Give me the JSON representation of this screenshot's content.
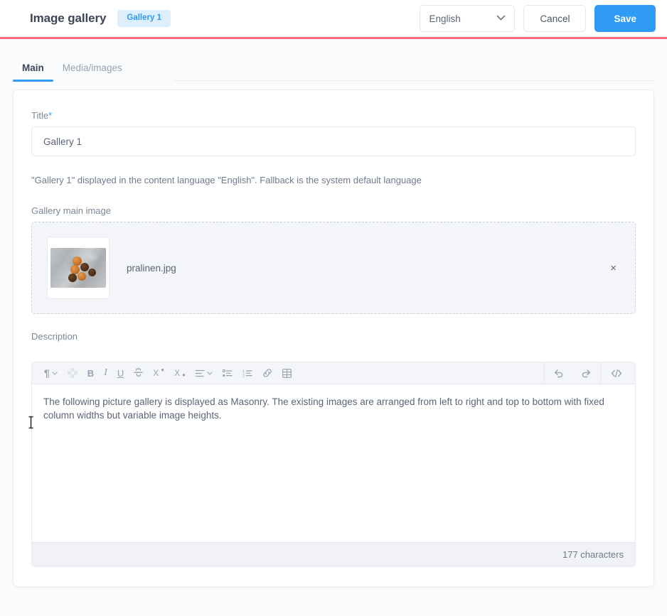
{
  "header": {
    "title": "Image gallery",
    "badge": "Gallery 1",
    "language": "English",
    "cancel_label": "Cancel",
    "save_label": "Save",
    "accent_color": "#2f9bf5",
    "rule_color": "#f4697c"
  },
  "tabs": [
    {
      "label": "Main",
      "active": true
    },
    {
      "label": "Media/images",
      "active": false
    }
  ],
  "form": {
    "title_label": "Title",
    "title_required_marker": "*",
    "title_value": "Gallery 1",
    "help_text": "\"Gallery 1\" displayed in the content language \"English\". Fallback is the system default language",
    "main_image_label": "Gallery main image",
    "image_file_name": "pralinen.jpg",
    "remove_label": "×",
    "description_label": "Description"
  },
  "editor": {
    "toolbar_left": [
      {
        "name": "paragraph-style",
        "glyph": "¶",
        "has_chevron": true
      },
      {
        "name": "clear-formatting",
        "glyph": "",
        "has_chevron": false
      },
      {
        "name": "bold",
        "glyph": "B",
        "has_chevron": false
      },
      {
        "name": "italic",
        "glyph": "I",
        "has_chevron": false
      },
      {
        "name": "underline",
        "glyph": "U",
        "has_chevron": false
      },
      {
        "name": "strikethrough",
        "glyph": "S",
        "has_chevron": false
      },
      {
        "name": "superscript",
        "glyph": "X",
        "has_chevron": false
      },
      {
        "name": "subscript",
        "glyph": "X",
        "has_chevron": false
      },
      {
        "name": "align",
        "glyph": "",
        "has_chevron": true
      },
      {
        "name": "bullet-list",
        "glyph": "",
        "has_chevron": false
      },
      {
        "name": "numbered-list",
        "glyph": "",
        "has_chevron": false
      },
      {
        "name": "link",
        "glyph": "",
        "has_chevron": false
      },
      {
        "name": "table",
        "glyph": "",
        "has_chevron": false
      }
    ],
    "toolbar_right": [
      {
        "name": "undo",
        "glyph": ""
      },
      {
        "name": "redo",
        "glyph": ""
      },
      {
        "name": "source-code",
        "glyph": "<>"
      }
    ],
    "content": "The following picture gallery is displayed as Masonry. The existing images are arranged from left to right and top to bottom with fixed column widths but variable image heights.",
    "character_count": "177 characters"
  }
}
